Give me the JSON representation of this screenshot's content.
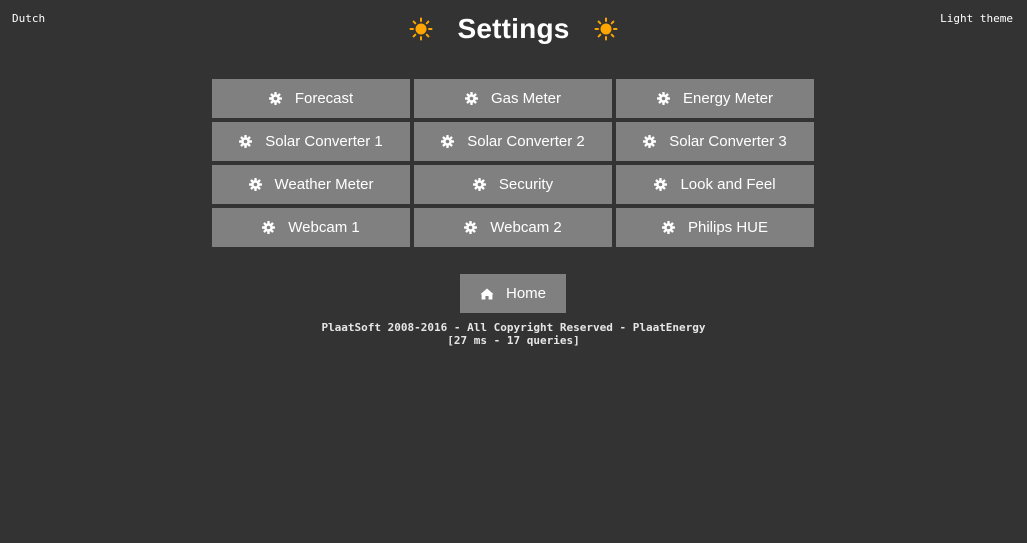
{
  "header": {
    "language_link": "Dutch",
    "theme_link": "Light theme",
    "title": "Settings",
    "icons": [
      "sun-icon",
      "sun-icon"
    ]
  },
  "menu": {
    "items": [
      {
        "label": "Forecast",
        "icon": "gear-icon"
      },
      {
        "label": "Gas Meter",
        "icon": "gear-icon"
      },
      {
        "label": "Energy Meter",
        "icon": "gear-icon"
      },
      {
        "label": "Solar Converter 1",
        "icon": "gear-icon"
      },
      {
        "label": "Solar Converter 2",
        "icon": "gear-icon"
      },
      {
        "label": "Solar Converter 3",
        "icon": "gear-icon"
      },
      {
        "label": "Weather Meter",
        "icon": "gear-icon"
      },
      {
        "label": "Security",
        "icon": "gear-icon"
      },
      {
        "label": "Look and Feel",
        "icon": "gear-icon"
      },
      {
        "label": "Webcam 1",
        "icon": "gear-icon"
      },
      {
        "label": "Webcam 2",
        "icon": "gear-icon"
      },
      {
        "label": "Philips HUE",
        "icon": "gear-icon"
      }
    ]
  },
  "home": {
    "label": "Home",
    "icon": "home-icon"
  },
  "footer": {
    "copyright": "PlaatSoft 2008-2016 - All Copyright Reserved - PlaatEnergy",
    "stats": "[27 ms - 17 queries]"
  },
  "colors": {
    "background": "#333333",
    "button": "#808080",
    "text": "#ffffff",
    "sun": "#ffa500"
  }
}
